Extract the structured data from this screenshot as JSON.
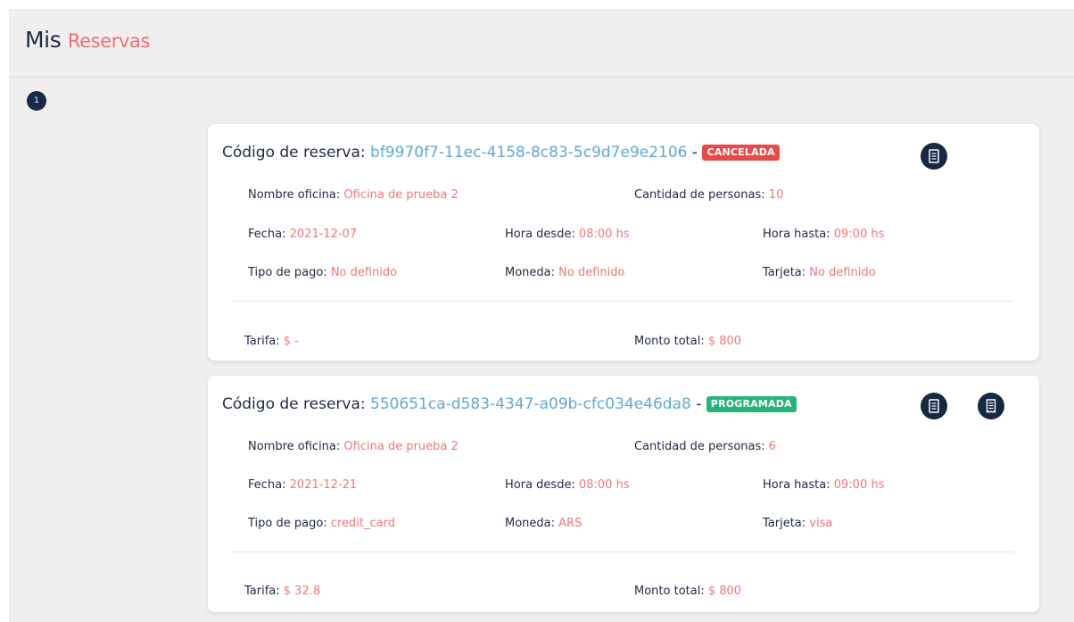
{
  "header": {
    "title_prefix": "Mis",
    "title_accent": "Reservas"
  },
  "pagination": {
    "current_page": "1"
  },
  "reservations": [
    {
      "code_label": "Código de reserva:",
      "code": "bf9970f7-11ec-4158-8c83-5c9d7e9e2106",
      "separator": "-",
      "status": "CANCELADA",
      "status_color": "#e84a4a",
      "actions": [
        "receipt-icon"
      ],
      "office_label": "Nombre oficina:",
      "office": "Oficina de prueba 2",
      "people_label": "Cantidad de personas:",
      "people": "10",
      "date_label": "Fecha:",
      "date": "2021-12-07",
      "from_label": "Hora desde:",
      "from": "08:00 hs",
      "to_label": "Hora hasta:",
      "to": "09:00 hs",
      "payment_type_label": "Tipo de pago:",
      "payment_type": "No definido",
      "currency_label": "Moneda:",
      "currency": "No definido",
      "card_label": "Tarjeta:",
      "card": "No definido",
      "rate_label": "Tarifa:",
      "rate": "$ -",
      "total_label": "Monto total:",
      "total": "$ 800"
    },
    {
      "code_label": "Código de reserva:",
      "code": "550651ca-d583-4347-a09b-cfc034e46da8",
      "separator": "-",
      "status": "PROGRAMADA",
      "status_color": "#28b37a",
      "actions": [
        "receipt-icon",
        "document-icon"
      ],
      "office_label": "Nombre oficina:",
      "office": "Oficina de prueba 2",
      "people_label": "Cantidad de personas:",
      "people": "6",
      "date_label": "Fecha:",
      "date": "2021-12-21",
      "from_label": "Hora desde:",
      "from": "08:00 hs",
      "to_label": "Hora hasta:",
      "to": "09:00 hs",
      "payment_type_label": "Tipo de pago:",
      "payment_type": "credit_card",
      "currency_label": "Moneda:",
      "currency": "ARS",
      "card_label": "Tarjeta:",
      "card": "visa",
      "rate_label": "Tarifa:",
      "rate": "$ 32.8",
      "total_label": "Monto total:",
      "total": "$ 800"
    }
  ]
}
